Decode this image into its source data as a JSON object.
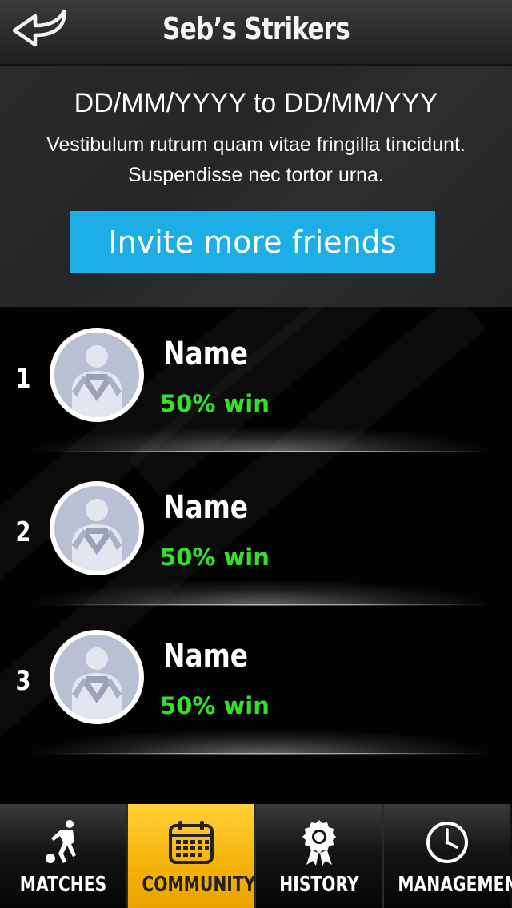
{
  "header": {
    "title": "Seb’s Strikers",
    "back_icon": "back-arrow-icon"
  },
  "info": {
    "date_range": "DD/MM/YYYY to DD/MM/YYY",
    "description": "Vestibulum rutrum quam vitae fringilla tincidunt. Suspendisse nec tortor urna.",
    "invite_label": "Invite more friends"
  },
  "members": [
    {
      "rank": "1",
      "name": "Name",
      "win": "50% win",
      "avatar_icon": "superhero-avatar-icon"
    },
    {
      "rank": "2",
      "name": "Name",
      "win": "50% win",
      "avatar_icon": "superhero-avatar-icon"
    },
    {
      "rank": "3",
      "name": "Name",
      "win": "50% win",
      "avatar_icon": "superhero-avatar-icon"
    }
  ],
  "tabs": [
    {
      "label": "MATCHES",
      "icon": "soccer-player-icon",
      "active": false
    },
    {
      "label": "COMMUNITY",
      "icon": "calendar-icon",
      "active": true
    },
    {
      "label": "HISTORY",
      "icon": "award-ribbon-icon",
      "active": false
    },
    {
      "label": "MANAGEMENT",
      "icon": "clock-icon",
      "active": false
    }
  ],
  "colors": {
    "accent_blue": "#1eaee6",
    "win_green": "#33e02a",
    "active_tab": "#f6b40c"
  }
}
